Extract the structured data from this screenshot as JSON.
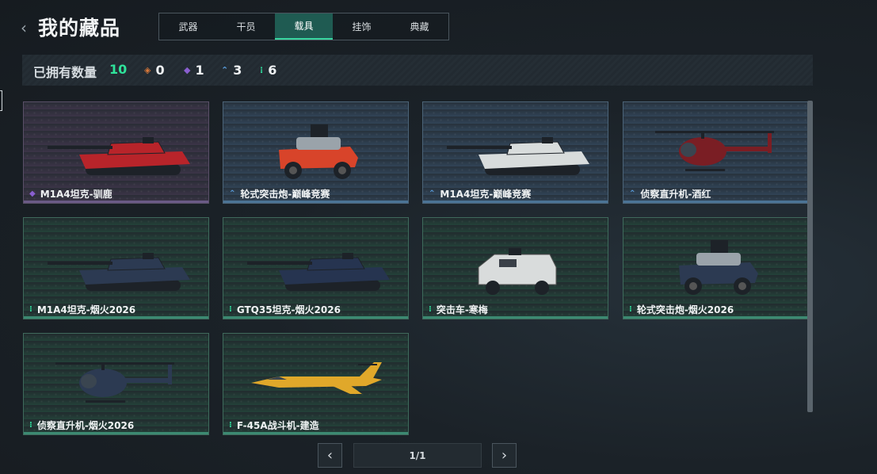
{
  "header": {
    "back_icon": "chevron-left-icon",
    "title": "我的藏品"
  },
  "tabs": [
    {
      "label": "武器",
      "active": false
    },
    {
      "label": "干员",
      "active": false
    },
    {
      "label": "载具",
      "active": true
    },
    {
      "label": "挂饰",
      "active": false
    },
    {
      "label": "典藏",
      "active": false
    }
  ],
  "summary": {
    "label": "已拥有数量",
    "total": "10",
    "tiers": [
      {
        "icon": "orange-diamond-icon",
        "color": "#d9783a",
        "count": "0"
      },
      {
        "icon": "purple-diamond-icon",
        "color": "#8a5fd0",
        "count": "1"
      },
      {
        "icon": "blue-chevron-icon",
        "color": "#5a9fe0",
        "count": "3"
      },
      {
        "icon": "green-dots-icon",
        "color": "#2fd89a",
        "count": "6"
      }
    ]
  },
  "colors": {
    "accent": "#2fe29a",
    "purple": "#8a5fd0",
    "blue": "#5a9fe0",
    "green": "#2fd89a"
  },
  "items": [
    {
      "name": "M1A4坦克-驯鹿",
      "rarity": "purple",
      "vehicle": "tank",
      "paint": "#b8242a"
    },
    {
      "name": "轮式突击炮-巅峰竞赛",
      "rarity": "blue",
      "vehicle": "wheeled",
      "paint": "#d8442a"
    },
    {
      "name": "M1A4坦克-巅峰竞赛",
      "rarity": "blue",
      "vehicle": "tank",
      "paint": "#d8dcdc"
    },
    {
      "name": "侦察直升机-酒红",
      "rarity": "blue",
      "vehicle": "heli",
      "paint": "#7a1e24"
    },
    {
      "name": "M1A4坦克-烟火2026",
      "rarity": "green",
      "vehicle": "tank",
      "paint": "#2c3a52"
    },
    {
      "name": "GTQ35坦克-烟火2026",
      "rarity": "green",
      "vehicle": "tank",
      "paint": "#263450"
    },
    {
      "name": "突击车-寒梅",
      "rarity": "green",
      "vehicle": "apc",
      "paint": "#d9dcdc"
    },
    {
      "name": "轮式突击炮-烟火2026",
      "rarity": "green",
      "vehicle": "wheeled",
      "paint": "#2c3a52"
    },
    {
      "name": "侦察直升机-烟火2026",
      "rarity": "green",
      "vehicle": "heli",
      "paint": "#2c3a52"
    },
    {
      "name": "F-45A战斗机-建造",
      "rarity": "green",
      "vehicle": "jet",
      "paint": "#e0a82a"
    }
  ],
  "pager": {
    "prev_icon": "chevron-left-icon",
    "page": "1/1",
    "next_icon": "chevron-right-icon"
  }
}
